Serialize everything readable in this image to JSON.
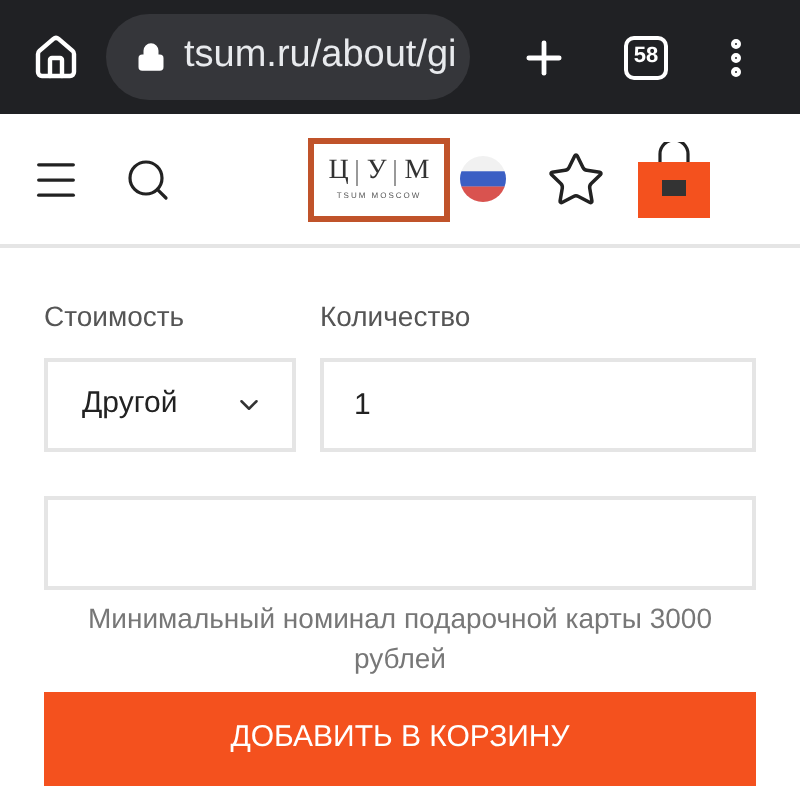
{
  "browser": {
    "url": "tsum.ru/about/gi",
    "tab_count": "58"
  },
  "header": {
    "logo": {
      "letters": [
        "Ц",
        "У",
        "М"
      ],
      "tagline": "TSUM MOSCOW"
    }
  },
  "form": {
    "cost_label": "Стоимость",
    "cost_value": "Другой",
    "quantity_label": "Количество",
    "quantity_value": "1",
    "hint": "Минимальный номинал подарочной карты 3000 рублей",
    "add_button": "ДОБАВИТЬ В КОРЗИНУ"
  }
}
